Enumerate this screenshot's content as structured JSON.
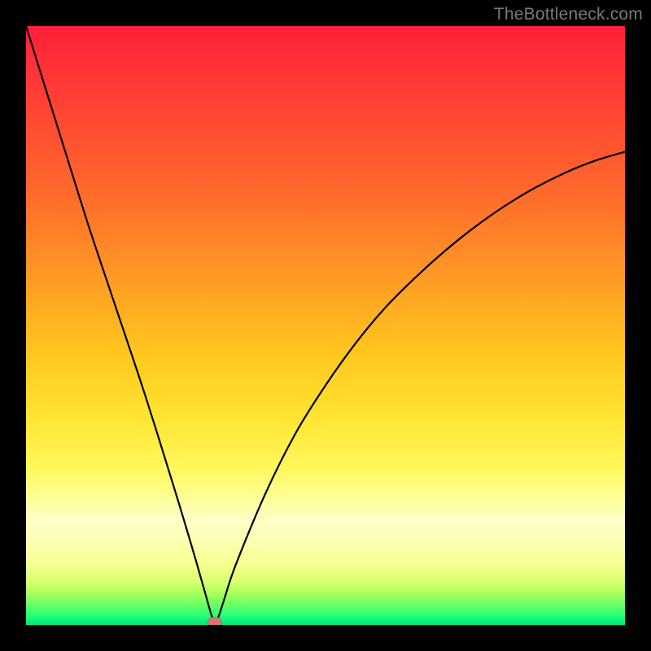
{
  "watermark": "TheBottleneck.com",
  "chart_data": {
    "type": "line",
    "title": "",
    "xlabel": "",
    "ylabel": "",
    "xlim": [
      0,
      100
    ],
    "ylim": [
      0,
      100
    ],
    "grid": false,
    "legend": false,
    "series": [
      {
        "name": "bottleneck-curve",
        "x": [
          0,
          5,
          10,
          15,
          20,
          25,
          28,
          30,
          31,
          31.5,
          32,
          33,
          35,
          40,
          45,
          50,
          55,
          60,
          65,
          70,
          75,
          80,
          85,
          90,
          95,
          100
        ],
        "values": [
          100,
          84,
          68,
          53,
          38,
          22,
          12,
          5,
          1.5,
          0.5,
          1,
          4,
          10,
          22,
          32,
          40,
          47,
          53,
          58,
          62.5,
          66.5,
          70,
          73,
          75.5,
          77.5,
          79
        ]
      }
    ],
    "marker": {
      "x": 31.5,
      "y": 0.5,
      "color": "#cf7a72"
    },
    "background_gradient": {
      "top": "#ff1f3a",
      "mid_upper": "#ff9a25",
      "mid": "#ffe634",
      "band": "#feffc6",
      "bottom": "#00e47a"
    }
  }
}
